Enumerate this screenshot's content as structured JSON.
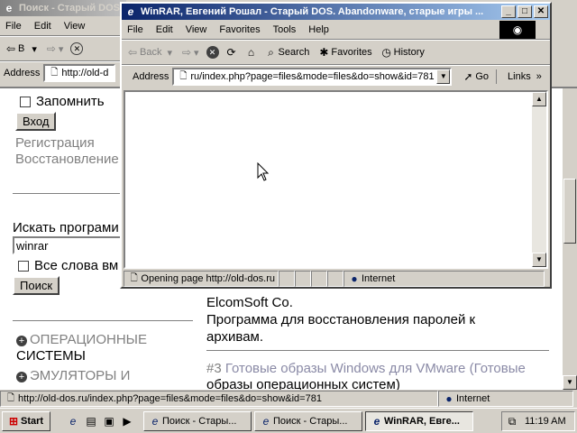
{
  "colors": {
    "titlebar_active": "#0a246a",
    "titlebar_inactive": "#808080",
    "desktop": "#008080",
    "link_gray": "#8a8aa6"
  },
  "bg_window": {
    "title": "Поиск - Старый DOS",
    "menu": [
      "File",
      "Edit",
      "View"
    ],
    "toolbar_back": "B",
    "address_label": "Address",
    "address_value": "http://old-d",
    "page": {
      "remember": "Запомнить",
      "login_button": "Вход",
      "register": "Регистрация",
      "restore": "Восстановление",
      "search_label": "Искать програми",
      "search_value": "winrar",
      "all_words": "Все слова вм",
      "search_button": "Поиск",
      "company": "ElcomSoft Co.",
      "desc1": "Программа для восстановления паролей к",
      "desc2": "архивам.",
      "cat1a": "ОПЕРАЦИОННЫЕ",
      "cat1b": "СИСТЕМЫ",
      "cat2": "ЭМУЛЯТОРЫ И",
      "result_num": "#3",
      "result_title1": "Готовые образы Windows для VMware",
      "result_title2": "(Готовые",
      "result_title3": "образы операционных систем)"
    },
    "status_url": "http://old-dos.ru/index.php?page=files&mode=files&do=show&id=781",
    "status_zone": "Internet"
  },
  "popup": {
    "title": "WinRAR, Евгений Рошал - Старый DOS. Abandonware, старые игры ...",
    "menu": [
      "File",
      "Edit",
      "View",
      "Favorites",
      "Tools",
      "Help"
    ],
    "toolbar": {
      "back": "Back",
      "search": "Search",
      "favorites": "Favorites",
      "history": "History"
    },
    "address_label": "Address",
    "address_value": "ru/index.php?page=files&mode=files&do=show&id=781",
    "go": "Go",
    "links": "Links",
    "status_text": "Opening page http://old-dos.ru",
    "status_zone": "Internet"
  },
  "taskbar": {
    "start": "Start",
    "tasks": [
      "Поиск - Стары...",
      "Поиск - Стары...",
      "WinRAR, Евге..."
    ],
    "clock": "11:19 AM"
  }
}
